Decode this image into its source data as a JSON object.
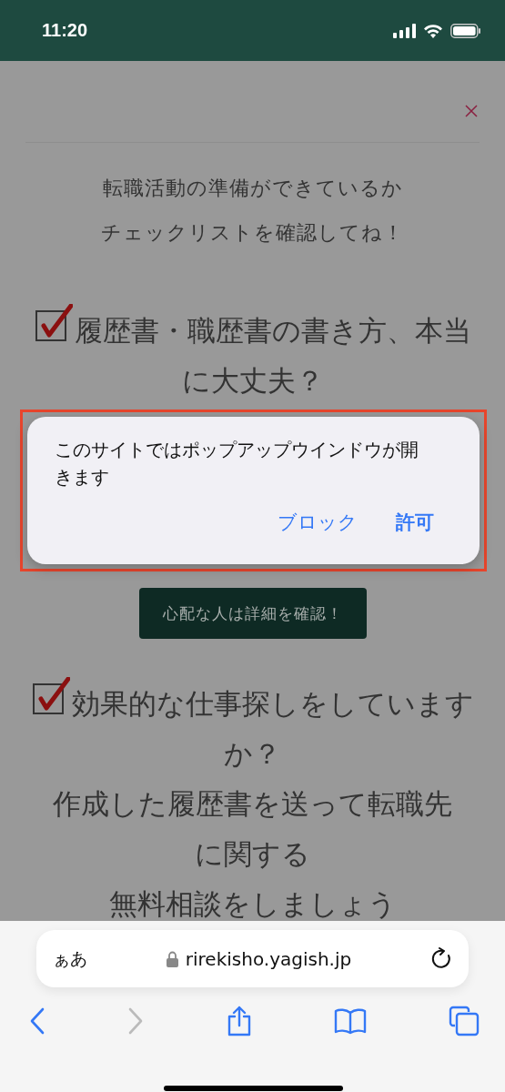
{
  "status_bar": {
    "time": "11:20"
  },
  "page": {
    "heading": [
      "転職活動の準備ができているか",
      "チェックリストを確認してね！"
    ],
    "sections": [
      {
        "checked": true,
        "title": "履歴書・職歴書の書き方、本当に大丈夫？",
        "button": "心配な人は詳細を確認！"
      },
      {
        "checked": true,
        "title": "効果的な仕事探しをしていますか？",
        "lines": [
          "作成した履歴書を送って転職先に関する",
          "無料相談をしましょう"
        ]
      }
    ]
  },
  "popup": {
    "message": "このサイトではポップアップウインドウが開きます",
    "actions": [
      {
        "label": "ブロック",
        "kind": "cancel"
      },
      {
        "label": "許可",
        "kind": "default"
      }
    ]
  },
  "browser": {
    "text_size_label": "ぁあ",
    "url": "rirekisho.yagish.jp",
    "toolbar": [
      {
        "kind": "back",
        "disabled": false
      },
      {
        "kind": "forward",
        "disabled": true
      },
      {
        "kind": "share",
        "disabled": false
      },
      {
        "kind": "bookmarks",
        "disabled": false
      },
      {
        "kind": "tabs",
        "disabled": false
      }
    ]
  }
}
